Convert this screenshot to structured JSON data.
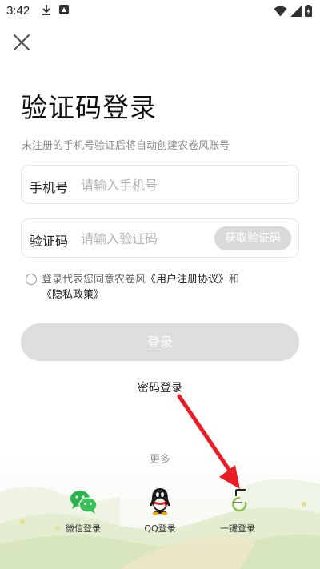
{
  "status_bar": {
    "time": "3:42"
  },
  "header": {
    "close_icon": "close-icon"
  },
  "page": {
    "title": "验证码登录",
    "subtitle": "未注册的手机号验证后将自动创建农卷风账号"
  },
  "phone_field": {
    "label": "手机号",
    "placeholder": "请输入手机号",
    "value": ""
  },
  "code_field": {
    "label": "验证码",
    "placeholder": "请输入验证码",
    "value": "",
    "get_code_label": "获取验证码"
  },
  "agreement": {
    "prefix": "登录代表您同意农卷风",
    "user_agreement": "《用户注册协议》",
    "and": "和",
    "privacy_policy": "《隐私政策》",
    "checked": false
  },
  "login_button": {
    "label": "登录"
  },
  "password_login": {
    "label": "密码登录"
  },
  "more": {
    "label": "更多"
  },
  "social_logins": [
    {
      "label": "微信登录",
      "icon": "wechat-icon"
    },
    {
      "label": "QQ登录",
      "icon": "qq-icon"
    },
    {
      "label": "一键登录",
      "icon": "loading-icon"
    }
  ],
  "colors": {
    "disabled_button": "#dedede",
    "input_border": "#e4e4e4",
    "arrow": "#ea1c24",
    "wechat": "#2bb24c"
  }
}
